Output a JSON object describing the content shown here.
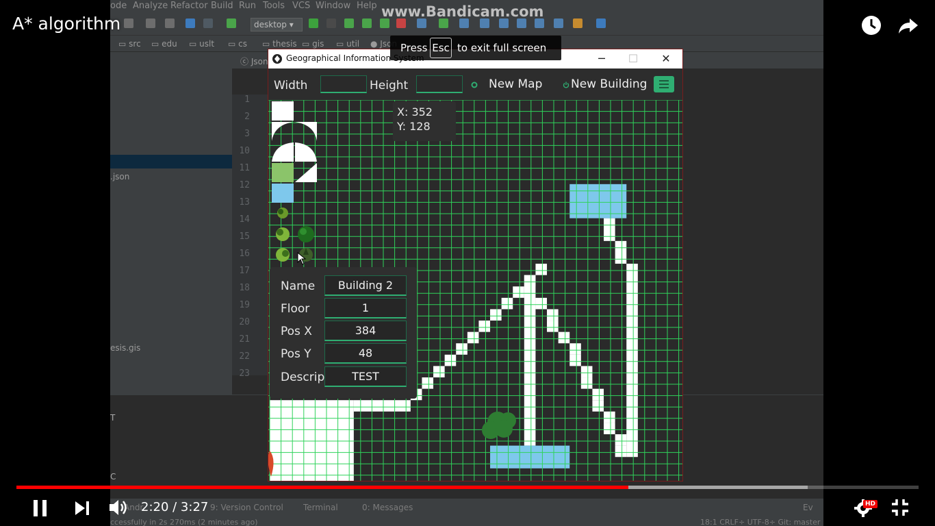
{
  "video": {
    "title": "A* algorithm",
    "watermark": "www.Bandicam.com",
    "fullscreen_hint": {
      "before": "Press",
      "key": "Esc",
      "after": "to exit full screen"
    },
    "time": "2:20 / 3:27",
    "progress_fraction": 0.678,
    "buffered_fraction": 0.877,
    "hd_label": "HD",
    "accent": "#ff0000"
  },
  "ide": {
    "menu": [
      "ode",
      "Analyze",
      "Refactor",
      "Build",
      "Run",
      "Tools",
      "VCS",
      "Window",
      "Help"
    ],
    "run_config": "desktop",
    "breadcrumbs": [
      "src",
      "edu",
      "uslt",
      "cs",
      "thesis",
      "gis",
      "util",
      "Json"
    ],
    "editor_tab": "Json",
    "tree_items": [
      ".json",
      "esis.gis"
    ],
    "line_numbers": [
      "1",
      "2",
      "3",
      "10",
      "11",
      "12",
      "13",
      "14",
      "15",
      "16",
      "17",
      "18",
      "19",
      "20",
      "21",
      "22",
      "23"
    ],
    "bottom_fragments": [
      "T",
      "C"
    ],
    "status_tabs": [
      "Andr",
      "9: Version Control",
      "Terminal",
      "0: Messages"
    ],
    "status_message": "ccessfully in 2s 270ms (2 minutes ago)",
    "status_right": "18:1  CRLF÷  UTF-8÷  Git: master ÷",
    "event_log": "Ev"
  },
  "gis": {
    "window_title": "Geographical Information System",
    "toolbar": {
      "width_label": "Width",
      "width_value": "",
      "height_label": "Height",
      "height_value": "",
      "new_map": "New Map",
      "new_building": "New Building"
    },
    "coords": {
      "x": "X: 352",
      "y": "Y: 128"
    },
    "form": {
      "rows": [
        {
          "label": "Name",
          "value": "Building 2"
        },
        {
          "label": "Floor",
          "value": "1"
        },
        {
          "label": "Pos X",
          "value": "384"
        },
        {
          "label": "Pos Y",
          "value": "48"
        },
        {
          "label": "Descript",
          "value": "TEST"
        }
      ]
    },
    "colors": {
      "grid_line": "#2fd35a",
      "background": "#2a2a2a",
      "road": "#ffffff",
      "water": "#7ec8ec",
      "grass": "#8bc46a",
      "tree": "#2e7d32",
      "accent": "#2fae72"
    },
    "palette_icons": [
      "road-full",
      "road-curve-left",
      "road-curve-right",
      "road-dome-left",
      "road-dome-right",
      "grass-tile",
      "road-diagonal",
      "water-tile",
      "tree-small",
      "tree-bush-1",
      "tree-large",
      "tree-bush-2",
      "tree-dark"
    ],
    "map_features": {
      "water_bodies": 2,
      "roads": "white road network forming a triangular path with vertical spine",
      "trees": "cluster of trees near map center"
    }
  }
}
